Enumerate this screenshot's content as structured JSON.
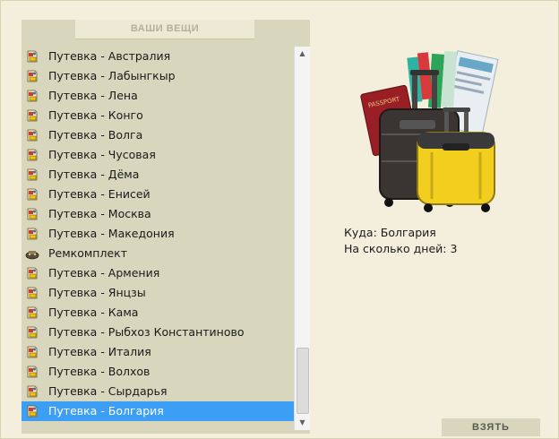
{
  "panel": {
    "title": "ВАШИ ВЕЩИ"
  },
  "items": [
    {
      "label": "Путевка - Австралия",
      "icon": "voucher-icon"
    },
    {
      "label": "Путевка - Лабынгкыр",
      "icon": "voucher-icon"
    },
    {
      "label": "Путевка - Лена",
      "icon": "voucher-icon"
    },
    {
      "label": "Путевка - Конго",
      "icon": "voucher-icon"
    },
    {
      "label": "Путевка - Волга",
      "icon": "voucher-icon"
    },
    {
      "label": "Путевка - Чусовая",
      "icon": "voucher-icon"
    },
    {
      "label": "Путевка - Дёма",
      "icon": "voucher-icon"
    },
    {
      "label": "Путевка - Енисей",
      "icon": "voucher-icon"
    },
    {
      "label": "Путевка - Москва",
      "icon": "voucher-icon"
    },
    {
      "label": "Путевка - Македония",
      "icon": "voucher-icon"
    },
    {
      "label": "Ремкомплект",
      "icon": "repair-kit-icon"
    },
    {
      "label": "Путевка - Армения",
      "icon": "voucher-icon"
    },
    {
      "label": "Путевка - Янцзы",
      "icon": "voucher-icon"
    },
    {
      "label": "Путевка - Кама",
      "icon": "voucher-icon"
    },
    {
      "label": "Путевка - Рыбхоз Константиново",
      "icon": "voucher-icon"
    },
    {
      "label": "Путевка - Италия",
      "icon": "voucher-icon"
    },
    {
      "label": "Путевка - Волхов",
      "icon": "voucher-icon"
    },
    {
      "label": "Путевка - Сырдарья",
      "icon": "voucher-icon"
    },
    {
      "label": "Путевка - Болгария",
      "icon": "voucher-icon",
      "selected": true
    }
  ],
  "details": {
    "destination": "Куда: Болгария",
    "days": "На сколько дней: 3",
    "image_icon": "luggage-passport-tickets-icon"
  },
  "actions": {
    "take_label": "ВЗЯТЬ"
  },
  "colors": {
    "page_bg": "#f3efdc",
    "panel_bg": "#d8d6bd",
    "selection": "#3c9ff5"
  }
}
